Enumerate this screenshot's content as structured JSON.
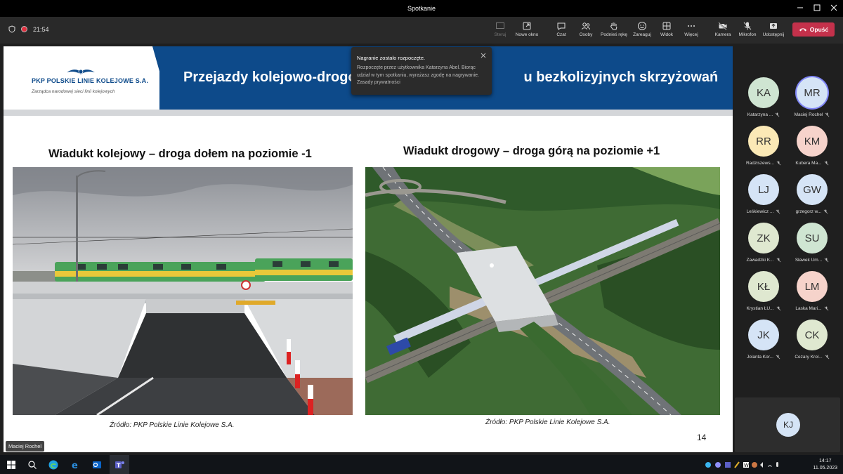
{
  "window": {
    "title": "Spotkanie"
  },
  "toolbar": {
    "time": "21:54",
    "buttons": {
      "share_stop": "Steruj",
      "new_window": "Nowe okno",
      "chat": "Czat",
      "people": "Osoby",
      "raise_hand": "Podnieś rękę",
      "react": "Zareaguj",
      "view": "Widok",
      "more": "Więcej",
      "camera": "Kamera",
      "mic": "Mikrofon",
      "share": "Udostępnij",
      "leave": "Opuść"
    }
  },
  "slide": {
    "logo_text": "PKP POLSKIE LINIE KOLEJOWE S.A.",
    "logo_sub": "Zarządca narodowej sieci linii kolejowych",
    "title": "Przejazdy kolejowo-drogowe",
    "title_tail": "u bezkolizyjnych skrzyżowań",
    "left_heading": "Wiadukt kolejowy – droga dołem na poziomie -1",
    "right_heading": "Wiadukt drogowy – droga górą na poziomie +1",
    "left_caption": "Źródło: PKP Polskie Linie Kolejowe S.A.",
    "right_caption": "Źródło: PKP Polskie Linie Kolejowe S.A.",
    "page_number": "14"
  },
  "notification": {
    "title": "Nagranie zostało rozpoczęte.",
    "body": "Rozpoczęte przez użytkownika Katarzyna Abel. Biorąc udział w tym spotkaniu, wyrażasz zgodę na nagrywanie. Zasady prywatności"
  },
  "presenter_chip": "Maciej Rochel",
  "participants": [
    {
      "initials": "KA",
      "name": "Katarzyna ...",
      "color": "#cfe5d2"
    },
    {
      "initials": "MR",
      "name": "Maciej Rochel",
      "color": "#d5e4f6"
    },
    {
      "initials": "RR",
      "name": "Radziszews...",
      "color": "#fbe9b6"
    },
    {
      "initials": "KM",
      "name": "Kubera Ma...",
      "color": "#f6d3cb"
    },
    {
      "initials": "LJ",
      "name": "Leśkiewicz ...",
      "color": "#d5e4f6"
    },
    {
      "initials": "GW",
      "name": "grzegorz w...",
      "color": "#d5e4f6"
    },
    {
      "initials": "ZK",
      "name": "Zawadzki K...",
      "color": "#dfe8d0"
    },
    {
      "initials": "SU",
      "name": "Sławek Um...",
      "color": "#cfe5d2"
    },
    {
      "initials": "KŁ",
      "name": "Krystian ŁU...",
      "color": "#dfe8d0"
    },
    {
      "initials": "LM",
      "name": "Laska Mari...",
      "color": "#f6d3cb"
    },
    {
      "initials": "JK",
      "name": "Jolanta Kor...",
      "color": "#d5e4f6"
    },
    {
      "initials": "CK",
      "name": "Cezary Krol...",
      "color": "#dfe8d0"
    }
  ],
  "self": {
    "initials": "KJ"
  },
  "taskbar": {
    "time": "14:17",
    "date": "11.05.2023"
  }
}
